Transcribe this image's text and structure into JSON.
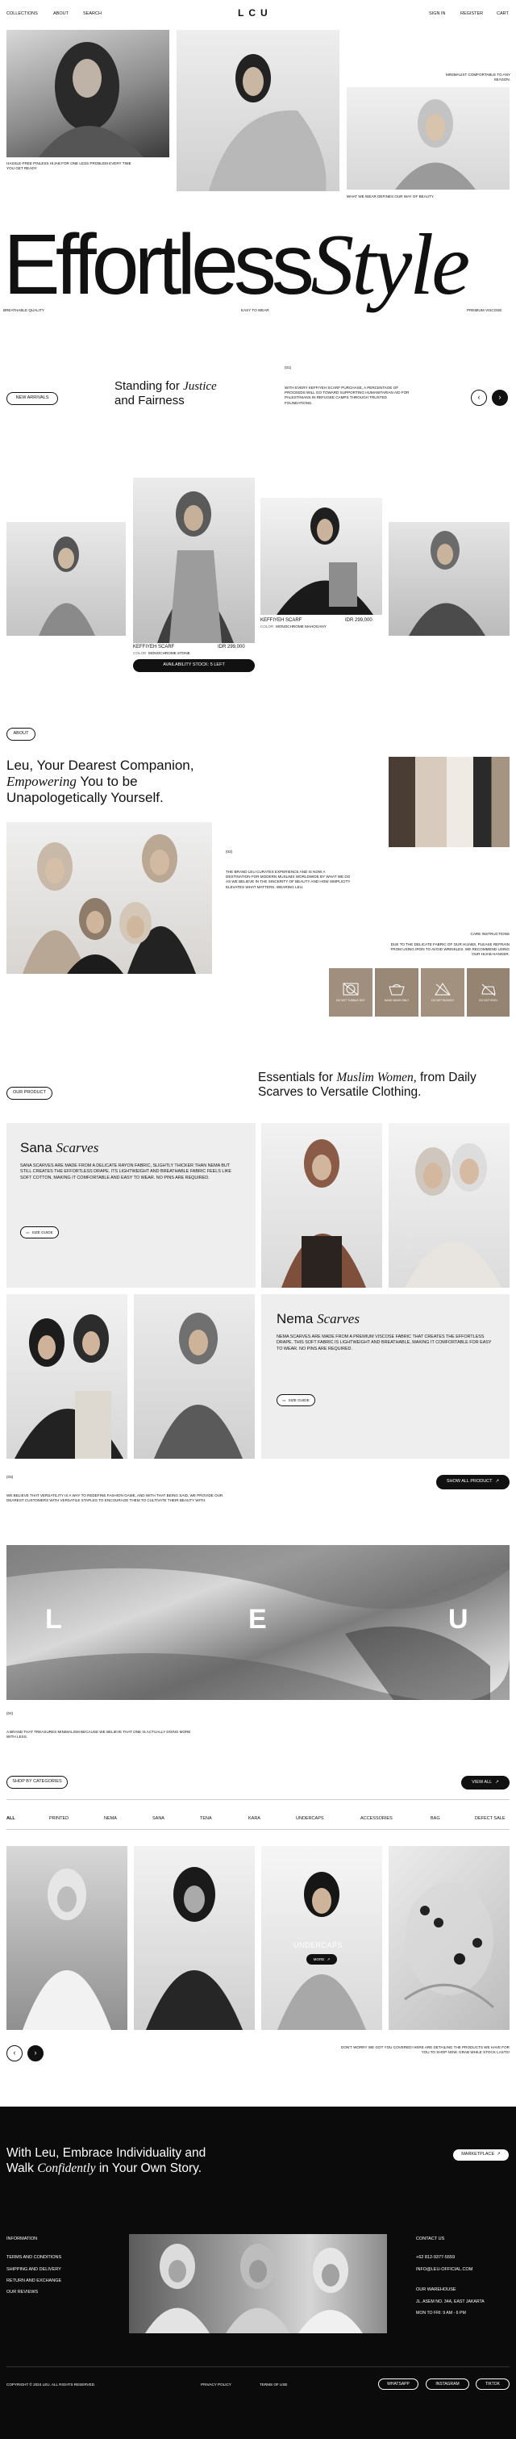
{
  "nav": {
    "left": [
      "Collections",
      "About",
      "Search"
    ],
    "right": [
      "Sign in",
      "Register",
      "Cart"
    ],
    "logo": "LCU"
  },
  "hero": {
    "caption_left": "Hassle-free pinless hijab for one less problem every time you get ready",
    "caption_right_top": "Minimalist comfortable to any season.",
    "caption_right_bottom": "What we wear defines our way of beauty",
    "headline_word": "Effortless",
    "headline_italic": "Style",
    "features": [
      "Breathable quality",
      "Easy to wear",
      "Premium viscose"
    ]
  },
  "arrivals": {
    "button": "New arrivals",
    "heading_a": "Standing for",
    "heading_italic": "Justice",
    "heading_b": "and Fairness",
    "number": "(01)",
    "body": "With every Keffiyeh scarf purchase, a percentage of proceeds will go toward supporting humanitarian aid for Palestinians in refugee camps through trusted foundations.",
    "prev": "‹",
    "next": "›",
    "products": [
      {
        "name": "Keffiyeh Scarf",
        "price": "IDR 299,000",
        "color_label": "Color",
        "color": "Monochrome Stone"
      },
      {
        "name": "Keffiyeh Scarf",
        "price": "IDR 299,000",
        "color_label": "Color",
        "color": "Monochrome Mahogany"
      }
    ],
    "stock": "Availability stock: 5 left"
  },
  "about": {
    "button": "About",
    "heading_1": "Leu, Your Dearest Companion,",
    "heading_italic": "Empowering",
    "heading_2": "You to be",
    "heading_3": "Unapologetically Yourself.",
    "number": "(02)",
    "body": "The brand Leu curates experience and is now a destination for modern Muslims worldwide by what we do as we believe in the sincerity of beauty and how simplicity elevates what matters. Wearing Leu.",
    "care_title": "Care instructions",
    "care_body": "Due to the delicate fabric of our hijabs, please refrain from using iron to avoid wrinkles. We recommend using our hijab hanger.",
    "care_icons": [
      "Do not tumble dry",
      "Hand wash only",
      "Do not bleach",
      "Do not iron"
    ]
  },
  "product": {
    "button": "Our product",
    "heading_a": "Essentials for",
    "heading_italic": "Muslim Women,",
    "heading_b": "from Daily",
    "heading_c": "Scarves to Versatile Clothing.",
    "sana": {
      "name": "Sana",
      "italic": "Scarves",
      "body": "Sana scarves are made from a delicate rayon fabric, slightly thicker than Nema but still creates the effortless drape. Its lightweight and breathable fabric feels like soft cotton, making it comfortable and easy to wear. No pins are required.",
      "guide": "Size guide"
    },
    "nema": {
      "name": "Nema",
      "italic": "Scarves",
      "body": "Nema scarves are made from a premium viscose fabric that creates the effortless drape. This soft fabric is lightweight and breathable, making it comfortable for easy to wear. No pins are required.",
      "guide": "Size guide"
    },
    "number": "(03)",
    "statement": "We believe that versatility is a way to redefine fashion game, and with that being said, we provide our dearest customers with versatile staples to encourage them to cultivate their beauty with.",
    "show_all": "Show all product"
  },
  "brand": {
    "letters": [
      "L",
      "E",
      "U"
    ],
    "number": "(04)",
    "statement": "A brand that treasures minimalism because we believe that one is actually doing more with less."
  },
  "categories": {
    "button": "Shop by categories",
    "view_all": "View all",
    "tabs": [
      "All",
      "Printed",
      "Nema",
      "Sana",
      "Tena",
      "Kara",
      "Undercaps",
      "Accessories",
      "Bag",
      "Defect Sale"
    ],
    "overlay_title": "Undercaps",
    "overlay_button": "More",
    "prev": "‹",
    "next": "›",
    "note": "Don't worry we got you covered! Here are detailing the products we have for you to shop now. Grab while stock lasts!"
  },
  "footer": {
    "heading_1": "With Leu, Embrace Individuality and",
    "heading_2a": "Walk",
    "heading_italic": "Confidently",
    "heading_2b": "in Your Own Story.",
    "marketplace": "Marketplace",
    "info_title": "Information",
    "info_links": [
      "Terms and conditions",
      "Shipping and delivery",
      "Return and exchange",
      "Our reviews"
    ],
    "contact_title": "Contact us",
    "phone": "+62 812-9377-5559",
    "email": "info@leu-official.com",
    "warehouse_title": "Our warehouse",
    "address": "Jl. Asem No. 34A, East Jakarta",
    "hours": "Mon to Fri: 9 AM - 6 PM",
    "copyright": "Copyright © 2024 Leu. All rights reserved.",
    "privacy": "Privacy policy",
    "terms": "Terms of use",
    "social": [
      "Whatsapp",
      "Instagram",
      "Tiktok"
    ]
  },
  "colors": {
    "ink": "#111111",
    "paper": "#ffffff",
    "beige": "#c9b9a8",
    "tile_bg": "#eeeeee"
  }
}
